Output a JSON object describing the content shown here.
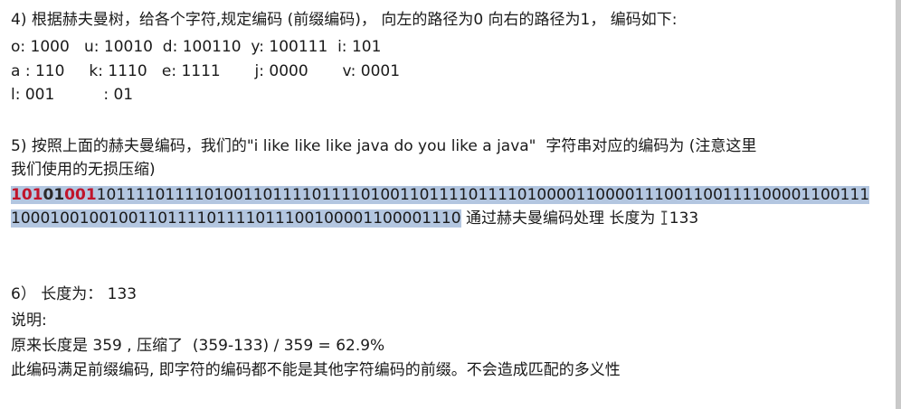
{
  "section4": {
    "heading": "4) 根据赫夫曼树，给各个字符,规定编码 (前缀编码)， 向左的路径为0 向右的路径为1， 编码如下:",
    "row1": "o: 1000   u: 10010  d: 100110  y: 100111  i: 101",
    "row2": "a : 110     k: 1110   e: 1111       j: 0000       v: 0001",
    "row3": "l: 001          : 01"
  },
  "section5": {
    "heading_line1": "5) 按照上面的赫夫曼编码，我们的\"i like like like java do you like a java\"  字符串对应的编码为 (注意这里",
    "heading_line2": "我们使用的无损压缩)",
    "code_red": "101",
    "code_dark": "01",
    "code_red2": "001",
    "code_rest_line1": "1011110111101001101111011110100110111101111010000110000111001100111100001100111",
    "code_line2": "1000100100100110111101111011100100001100001110",
    "code_suffix": " 通过赫夫曼编码处理 长度为 ",
    "cursor_glyph": "I",
    "code_length": "133"
  },
  "section6": {
    "heading": "6） 长度为： 133",
    "note_label": "说明:",
    "compression": "原来长度是 359 , 压缩了  (359-133) / 359 = 62.9%",
    "prefix_note": "此编码满足前缀编码, 即字符的编码都不能是其他字符编码的前缀。不会造成匹配的多义性"
  },
  "colors": {
    "selection": "#b3c6e0",
    "highlight_red": "#c0142b",
    "text": "#1a1a1a"
  }
}
